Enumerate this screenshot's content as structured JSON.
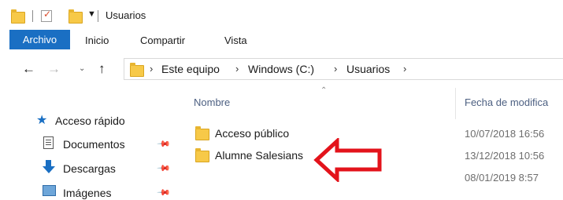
{
  "window": {
    "title": "Usuarios"
  },
  "ribbon": {
    "tabs": [
      "Archivo",
      "Inicio",
      "Compartir",
      "Vista"
    ]
  },
  "address": {
    "crumbs": [
      "Este equipo",
      "Windows (C:)",
      "Usuarios"
    ]
  },
  "sidebar": {
    "items": [
      {
        "label": "Acceso rápido",
        "icon": "star-icon"
      },
      {
        "label": "Documentos",
        "icon": "documents-icon"
      },
      {
        "label": "Descargas",
        "icon": "download-arrow-icon"
      },
      {
        "label": "Imágenes",
        "icon": "pictures-icon"
      }
    ]
  },
  "columns": {
    "name": "Nombre",
    "date": "Fecha de modifica"
  },
  "files": [
    {
      "name": "Acceso público",
      "date": "10/07/2018 16:56"
    },
    {
      "name": "Alumne Salesians",
      "date": "13/12/2018 10:56"
    },
    {
      "name": "",
      "date": "08/01/2019 8:57"
    }
  ],
  "colors": {
    "accent": "#1a6fc3",
    "arrow": "#e3131b",
    "folder": "#f7c948"
  }
}
